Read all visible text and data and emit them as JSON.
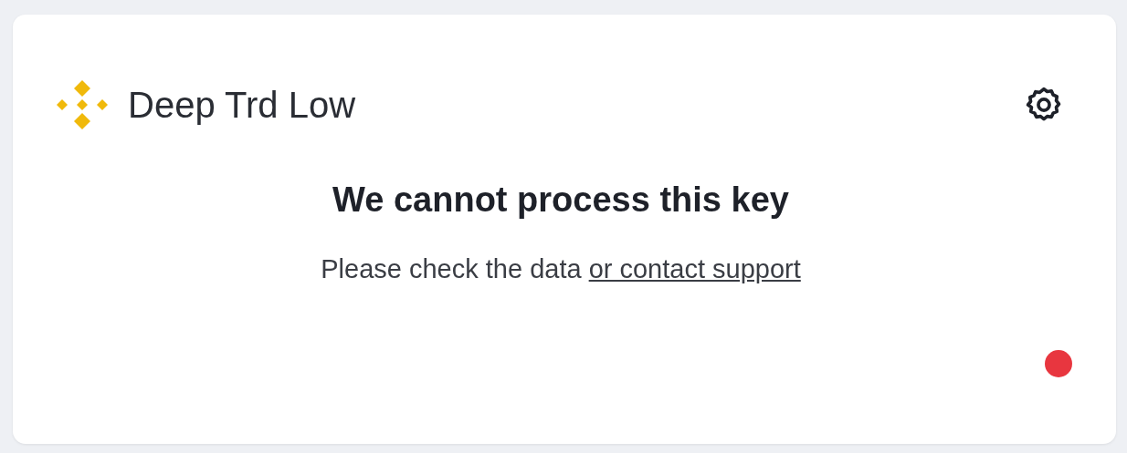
{
  "card": {
    "title": "Deep Trd Low",
    "message": {
      "heading": "We cannot process this key",
      "text": "Please check the data",
      "link": "or contact support"
    },
    "status_dot": {
      "color": "#e8363f"
    }
  }
}
